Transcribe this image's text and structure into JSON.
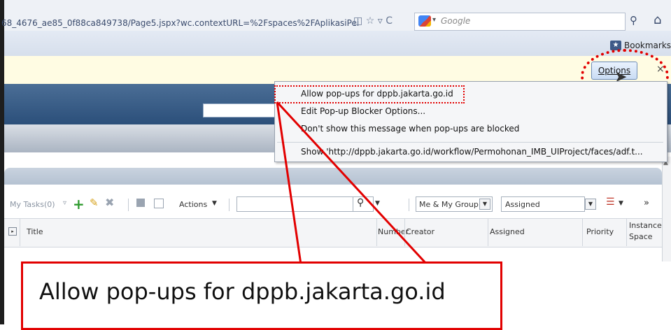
{
  "browser": {
    "url": "68_4676_ae85_0f88ca849738/Page5.jspx?wc.contextURL=%2Fspaces%2FAplikasiPei",
    "search_placeholder": "Google",
    "bookmarks_label": "Bookmarks"
  },
  "notification": {
    "options_label": "Options",
    "close_label": "×"
  },
  "popup_menu": {
    "items": [
      "Allow pop-ups for dppb.jakarta.go.id",
      "Edit Pop-up Blocker Options...",
      "Don't show this message when pop-ups are blocked",
      "Show 'http://dppb.jakarta.go.id/workflow/Permohonan_IMB_UIProject/faces/adf.t..."
    ]
  },
  "toolbar": {
    "my_tasks": "My Tasks(0)",
    "actions_label": "Actions",
    "group_value": "Me & My Group",
    "state_value": "Assigned"
  },
  "table": {
    "columns": [
      "Title",
      "Number",
      "Creator",
      "Assigned",
      "Priority",
      "Instance Space"
    ]
  },
  "zoom": {
    "text": "Allow pop-ups for dppb.jakarta.go.id"
  }
}
